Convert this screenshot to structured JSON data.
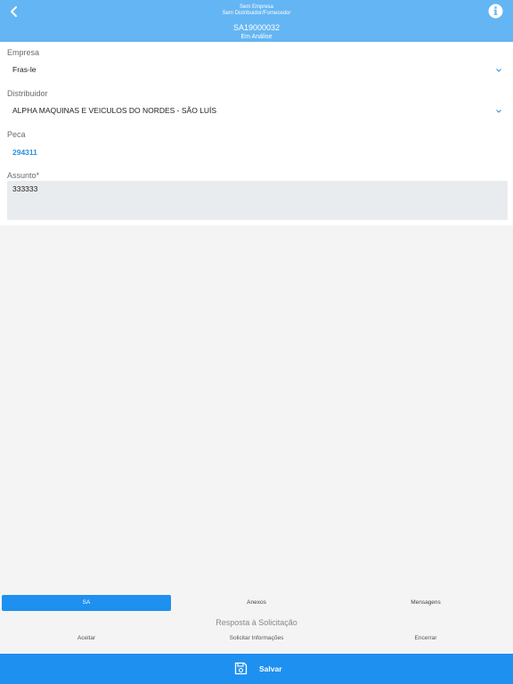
{
  "header": {
    "company_line": "Sem Empresa",
    "supplier_line": "Sem Distribuidor/Fornecedor",
    "code": "SA19000032",
    "status": "Em Análise"
  },
  "form": {
    "empresa": {
      "label": "Empresa",
      "value": "Fras-le"
    },
    "distribuidor": {
      "label": "Distribuidor",
      "value": "ALPHA MAQUINAS E VEICULOS DO NORDES - SÃO LUÍS"
    },
    "peca": {
      "label": "Peca",
      "value": "294311"
    },
    "assunto": {
      "label": "Assunto*",
      "value": "333333"
    }
  },
  "tabs": [
    {
      "label": "SA",
      "active": true
    },
    {
      "label": "Anexos",
      "active": false
    },
    {
      "label": "Mensagens",
      "active": false
    }
  ],
  "response": {
    "title": "Resposta à Solicitação",
    "actions": [
      "Aceitar",
      "Solicitar Informações",
      "Encerrar"
    ]
  },
  "save": {
    "label": "Salvar"
  },
  "colors": {
    "header_bg": "#64b5f3",
    "accent": "#1e90f0",
    "link": "#2b90e0"
  }
}
